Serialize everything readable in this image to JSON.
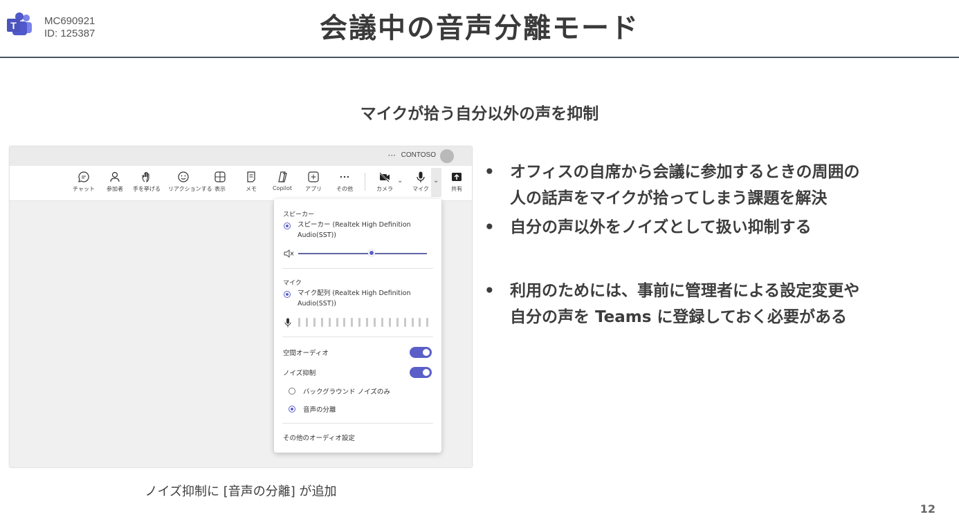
{
  "header": {
    "meta_line1": "MC690921",
    "meta_line2": "ID: 125387",
    "title": "会議中の音声分離モード"
  },
  "subtitle": "マイクが拾う自分以外の声を抑制",
  "teams": {
    "org_name": "CONTOSO",
    "more_dots": "···",
    "toolbar": [
      {
        "icon": "chat-icon",
        "label": "チャット"
      },
      {
        "icon": "people-icon",
        "label": "参加者"
      },
      {
        "icon": "raise-hand-icon",
        "label": "手を挙げる"
      },
      {
        "icon": "reaction-icon",
        "label": "リアクションする"
      },
      {
        "icon": "view-icon",
        "label": "表示"
      },
      {
        "icon": "notes-icon",
        "label": "メモ"
      },
      {
        "icon": "copilot-icon",
        "label": "Copilot"
      },
      {
        "icon": "apps-icon",
        "label": "アプリ"
      },
      {
        "icon": "more-icon",
        "label": "その他"
      },
      {
        "icon": "camera-icon",
        "label": "カメラ"
      },
      {
        "icon": "mic-icon",
        "label": "マイク"
      },
      {
        "icon": "share-icon",
        "label": "共有"
      }
    ],
    "flyout": {
      "speaker_heading": "スピーカー",
      "speaker_device_line1": "スピーカー (Realtek High Definition",
      "speaker_device_line2": "Audio(SST))",
      "speaker_volume": 0.57,
      "mic_heading": "マイク",
      "mic_device_line1": "マイク配列 (Realtek High Definition",
      "mic_device_line2": "Audio(SST))",
      "spatial_audio_label": "空間オーディオ",
      "spatial_audio_on": true,
      "noise_suppression_label": "ノイズ抑制",
      "noise_suppression_on": true,
      "option_background": "バックグラウンド ノイズのみ",
      "option_voice_isolation": "音声の分離",
      "selected_option": "音声の分離",
      "more_settings": "その他のオーディオ設定"
    }
  },
  "caption": "ノイズ抑制に [音声の分離] が追加",
  "bullets": [
    {
      "line1": "オフィスの自席から会議に参加するときの周囲の",
      "line2": "人の話声をマイクが拾ってしまう課題を解決"
    },
    {
      "line1": "自分の声以外をノイズとして扱い抑制する",
      "line2": ""
    },
    {
      "line1": "利用のためには、事前に管理者による設定変更や",
      "line2": "自分の声を Teams に登録しておく必要がある"
    }
  ],
  "bullet_symbol": "•",
  "page_number": "12",
  "colors": {
    "accent": "#5b5fc7",
    "teams_purple": "#5059c9",
    "header_rule": "#4a5560"
  }
}
